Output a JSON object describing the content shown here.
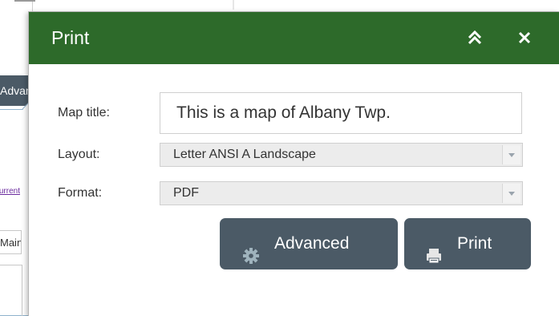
{
  "background": {
    "advanced_tab_label": "Advanced",
    "link_text": "Current",
    "input_value": "Main"
  },
  "dialog": {
    "title": "Print",
    "collapse_icon": "double-chevron-up-icon",
    "close_icon": "close-icon",
    "header_color": "#2d6a2a"
  },
  "form": {
    "map_title_label": "Map title:",
    "map_title_value": "This is a map of Albany Twp.",
    "layout_label": "Layout:",
    "layout_value": "Letter ANSI A Landscape",
    "format_label": "Format:",
    "format_value": "PDF"
  },
  "buttons": {
    "advanced_label": "Advanced",
    "advanced_icon": "gear-icon",
    "print_label": "Print",
    "print_icon": "printer-icon",
    "button_color": "#4b5a66"
  }
}
